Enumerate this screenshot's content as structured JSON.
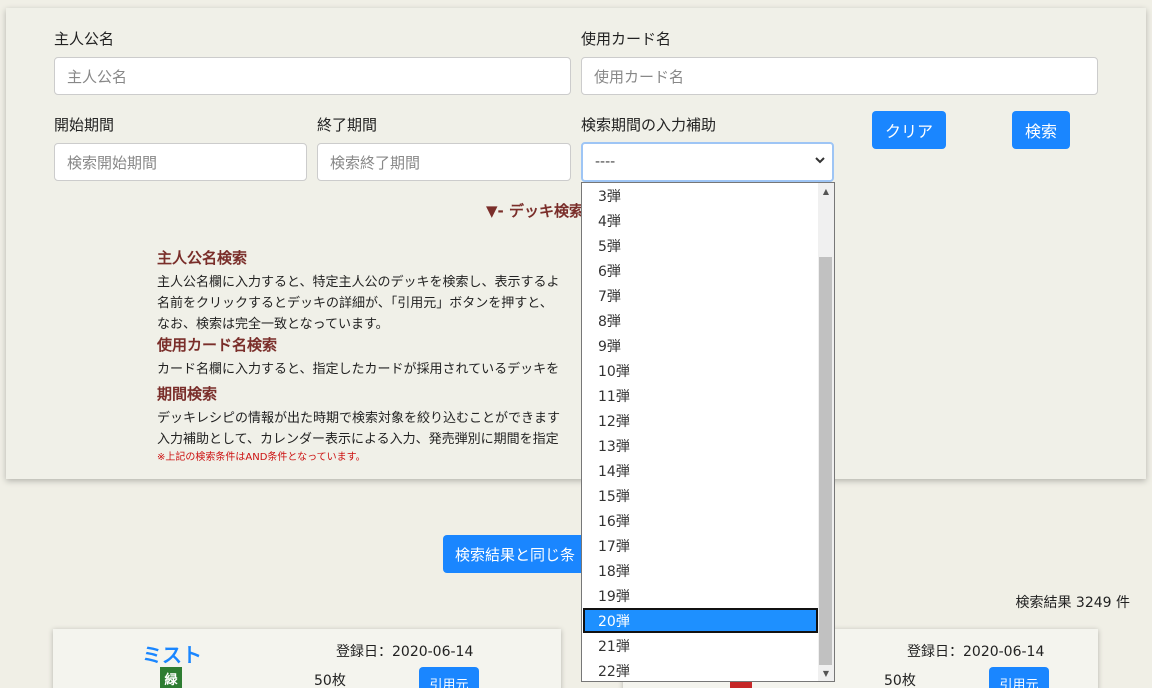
{
  "form": {
    "protagonist_label": "主人公名",
    "protagonist_placeholder": "主人公名",
    "card_label": "使用カード名",
    "card_placeholder": "使用カード名",
    "start_label": "開始期間",
    "start_placeholder": "検索開始期間",
    "end_label": "終了期間",
    "end_placeholder": "検索終了期間",
    "assist_label": "検索期間の入力補助",
    "assist_value": "----",
    "clear_button": "クリア",
    "search_button": "検索"
  },
  "help": {
    "toggle": "▼- デッキ検索",
    "h1": "主人公名検索",
    "t1a": "主人公名欄に入力すると、特定主人公のデッキを検索し、表示するよ",
    "t1b": "名前をクリックするとデッキの詳細が、「引用元」ボタンを押すと、",
    "t1c": "なお、検索は完全一致となっています。",
    "h2": "使用カード名検索",
    "t2": "カード名欄に入力すると、指定したカードが採用されているデッキを",
    "h3": "期間検索",
    "t3a": "デッキレシピの情報が出た時期で検索対象を絞り込むことができます",
    "t3b": "入力補助として、カレンダー表示による入力、発売弾別に期間を指定",
    "note": "※上記の検索条件はAND条件となっています。"
  },
  "results": {
    "copy_button": "検索結果と同じ条",
    "count": "検索結果 3249 件"
  },
  "cards": [
    {
      "name": "ミスト",
      "badge": "緑",
      "badge_color": "#2e7d32",
      "date": "登録日：2020-06-14",
      "count": "50枚",
      "source": "引用元"
    },
    {
      "name": "",
      "badge": "",
      "badge_color": "#c62828",
      "date": "登録日：2020-06-14",
      "count": "50枚",
      "source": "引用元"
    }
  ],
  "dropdown": {
    "options": [
      "3弾",
      "4弾",
      "5弾",
      "6弾",
      "7弾",
      "8弾",
      "9弾",
      "10弾",
      "11弾",
      "12弾",
      "13弾",
      "14弾",
      "15弾",
      "16弾",
      "17弾",
      "18弾",
      "19弾",
      "20弾",
      "21弾",
      "22弾"
    ],
    "selected": "20弾"
  },
  "colors": {
    "accent": "#1a86ff",
    "heading": "#7a2e2a",
    "note": "#cc1111"
  }
}
